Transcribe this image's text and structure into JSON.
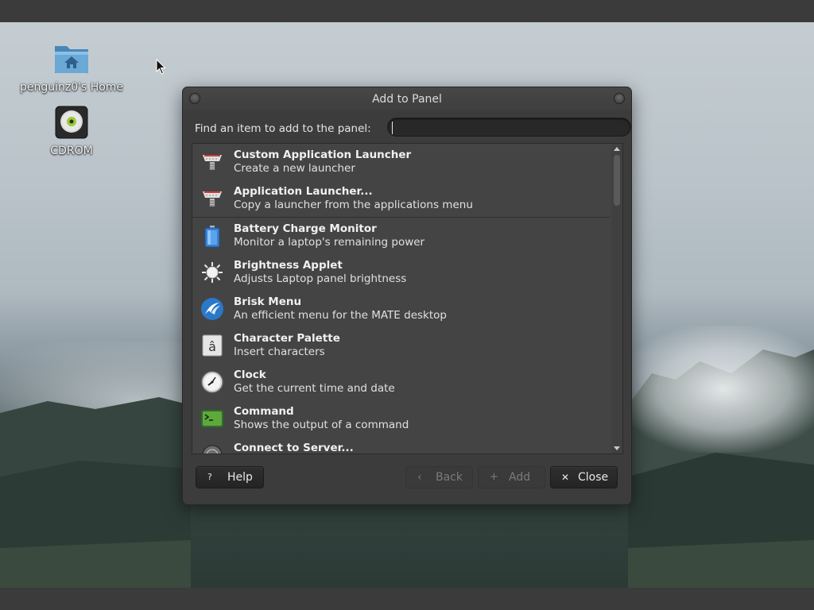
{
  "desktop": {
    "icons": [
      {
        "label": "penguinz0's Home"
      },
      {
        "label": "CDROM"
      }
    ]
  },
  "dialog": {
    "title": "Add to Panel",
    "search": {
      "label": "Find an item to add to the panel:",
      "value": "",
      "placeholder": ""
    },
    "items": [
      {
        "name": "Custom Application Launcher",
        "description": "Create a new launcher",
        "icon": "launcher-icon"
      },
      {
        "name": "Application Launcher...",
        "description": "Copy a launcher from the applications menu",
        "icon": "launcher-icon"
      },
      {
        "name": "Battery Charge Monitor",
        "description": "Monitor a laptop's remaining power",
        "icon": "battery-icon"
      },
      {
        "name": "Brightness Applet",
        "description": "Adjusts Laptop panel brightness",
        "icon": "brightness-icon"
      },
      {
        "name": "Brisk Menu",
        "description": "An efficient menu for the MATE desktop",
        "icon": "brisk-menu-icon"
      },
      {
        "name": "Character Palette",
        "description": "Insert characters",
        "icon": "character-palette-icon"
      },
      {
        "name": "Clock",
        "description": "Get the current time and date",
        "icon": "clock-icon"
      },
      {
        "name": "Command",
        "description": "Shows the output of a command",
        "icon": "terminal-icon"
      },
      {
        "name": "Connect to Server...",
        "description": "",
        "icon": "connect-server-icon"
      }
    ],
    "buttons": {
      "help": "Help",
      "back": "Back",
      "add": "Add",
      "close": "Close"
    }
  }
}
